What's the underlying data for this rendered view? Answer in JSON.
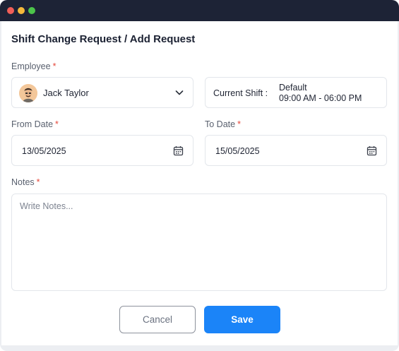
{
  "window": {
    "controls": [
      "close",
      "minimize",
      "maximize"
    ]
  },
  "page": {
    "title": "Shift Change Request / Add Request"
  },
  "form": {
    "employee": {
      "label": "Employee",
      "required_mark": "*",
      "value": "Jack Taylor",
      "avatar_icon": "user-avatar",
      "dropdown_icon": "chevron-down-icon"
    },
    "current_shift": {
      "label": "Current Shift :",
      "name": "Default",
      "time": "09:00 AM - 06:00 PM"
    },
    "from_date": {
      "label": "From Date",
      "required_mark": "*",
      "value": "13/05/2025",
      "icon": "calendar-icon"
    },
    "to_date": {
      "label": "To Date",
      "required_mark": "*",
      "value": "15/05/2025",
      "icon": "calendar-icon"
    },
    "notes": {
      "label": "Notes",
      "required_mark": "*",
      "placeholder": "Write Notes...",
      "value": ""
    }
  },
  "actions": {
    "cancel_label": "Cancel",
    "save_label": "Save"
  },
  "colors": {
    "titlebar": "#1d2336",
    "primary": "#1b84f8",
    "required": "#e5483b",
    "border": "#e3e6eb"
  }
}
